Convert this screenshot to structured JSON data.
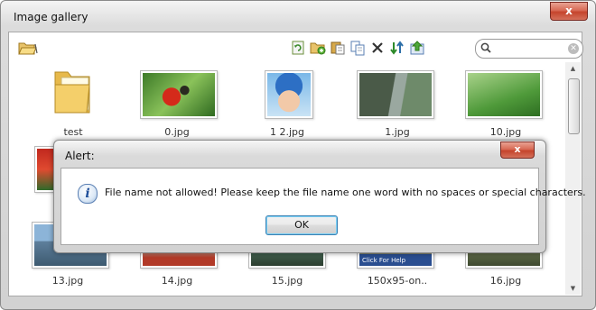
{
  "window": {
    "title": "Image gallery",
    "close_label": "x"
  },
  "toolbar": {
    "left_icon": "folder-open-icon",
    "icons": [
      "refresh-icon",
      "new-folder-icon",
      "paste-icon",
      "copy-icon",
      "delete-icon",
      "sort-icon",
      "upload-icon"
    ],
    "search_placeholder": "",
    "search_value": ""
  },
  "gallery": {
    "row1": [
      "test",
      "0.jpg",
      "1 2.jpg",
      "1.jpg",
      "10.jpg"
    ],
    "row3": [
      "13.jpg",
      "14.jpg",
      "15.jpg",
      "150x95-on..",
      "16.jpg"
    ],
    "partial_banner_text": "Click For Help"
  },
  "alert": {
    "title": "Alert:",
    "close_label": "x",
    "message": "File name not allowed! Please keep the file name one word with no spaces or special characters.",
    "ok_label": "OK",
    "icon": "info-icon"
  },
  "colors": {
    "close_red": "#c5442c",
    "ok_focus": "#3c7fb1"
  }
}
